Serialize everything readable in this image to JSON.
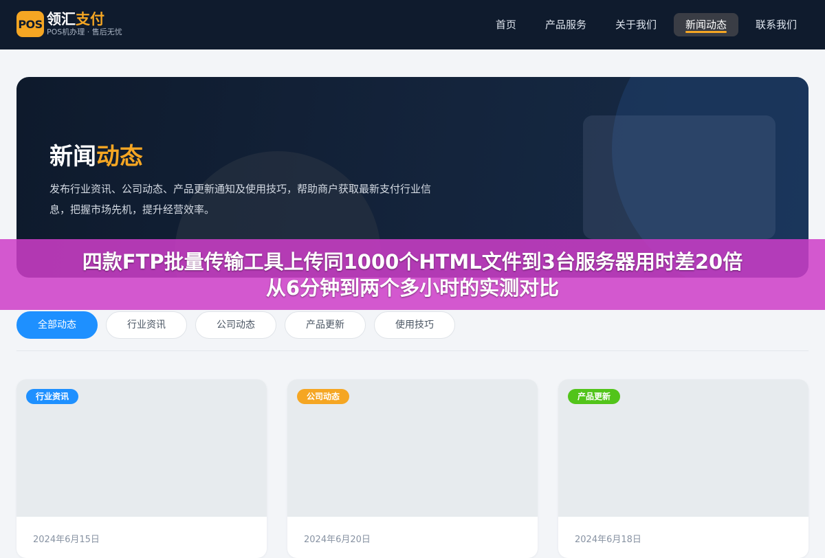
{
  "header": {
    "logo_mark": "POS",
    "brand_main": "领汇",
    "brand_accent": "支付",
    "tagline": "POS机办理 · 售后无忧",
    "nav": [
      {
        "label": "首页",
        "active": false
      },
      {
        "label": "产品服务",
        "active": false
      },
      {
        "label": "关于我们",
        "active": false
      },
      {
        "label": "新闻动态",
        "active": true
      },
      {
        "label": "联系我们",
        "active": false
      }
    ]
  },
  "hero": {
    "title_main": "新闻",
    "title_accent": "动态",
    "description": "发布行业资讯、公司动态、产品更新通知及使用技巧，帮助商户获取最新支付行业信息，把握市场先机，提升经营效率。"
  },
  "overlay": {
    "line1": "四款FTP批量传输工具上传同1000个HTML文件到3台服务器用时差20倍",
    "line2": "从6分钟到两个多小时的实测对比"
  },
  "filters": [
    {
      "label": "全部动态",
      "active": true
    },
    {
      "label": "行业资讯",
      "active": false
    },
    {
      "label": "公司动态",
      "active": false
    },
    {
      "label": "产品更新",
      "active": false
    },
    {
      "label": "使用技巧",
      "active": false
    }
  ],
  "cards": [
    {
      "badge": "行业资讯",
      "badge_color": "#1e90ff",
      "date": "2024年6月15日"
    },
    {
      "badge": "公司动态",
      "badge_color": "#f5a623",
      "date": "2024年6月20日"
    },
    {
      "badge": "产品更新",
      "badge_color": "#52c41a",
      "date": "2024年6月18日"
    }
  ],
  "colors": {
    "header_bg": "#0f1b2d",
    "accent_orange": "#f5a623",
    "primary_blue": "#1e90ff",
    "overlay_magenta": "#cd3ec8"
  }
}
